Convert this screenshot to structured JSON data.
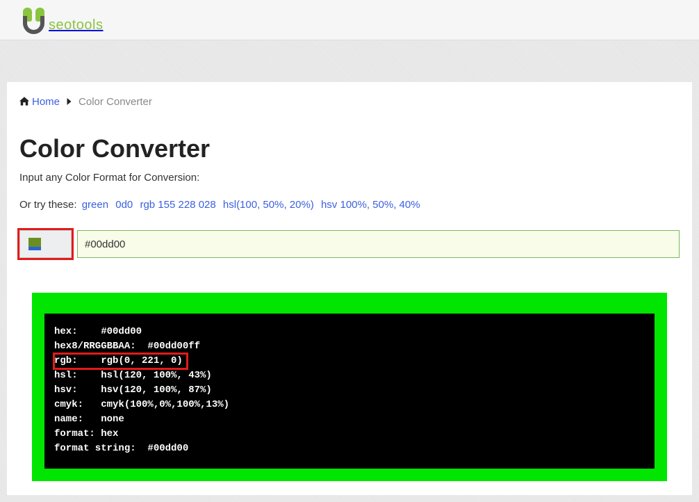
{
  "logo": {
    "text": "seotools"
  },
  "breadcrumb": {
    "home": "Home",
    "current": "Color Converter"
  },
  "header": {
    "title": "Color Converter",
    "subtitle": "Input any Color Format for Conversion:",
    "try_label": "Or try these:",
    "examples": [
      "green",
      "0d0",
      "rgb 155 228 028",
      "hsl(100, 50%, 20%)",
      "hsv 100%, 50%, 40%"
    ]
  },
  "input": {
    "value": "#00dd00"
  },
  "result": {
    "lines": [
      {
        "label": "hex:    ",
        "value": "#00dd00"
      },
      {
        "label": "hex8/RRGGBBAA:  ",
        "value": "#00dd00ff"
      },
      {
        "label": "rgb:    ",
        "value": "rgb(0, 221, 0)",
        "highlight": true
      },
      {
        "label": "hsl:    ",
        "value": "hsl(120, 100%, 43%)"
      },
      {
        "label": "hsv:    ",
        "value": "hsv(120, 100%, 87%)"
      },
      {
        "label": "cmyk:   ",
        "value": "cmyk(100%,0%,100%,13%)"
      },
      {
        "label": "name:   ",
        "value": "none"
      },
      {
        "label": "format: ",
        "value": "hex"
      },
      {
        "label": "format string:  ",
        "value": "#00dd00"
      }
    ]
  }
}
